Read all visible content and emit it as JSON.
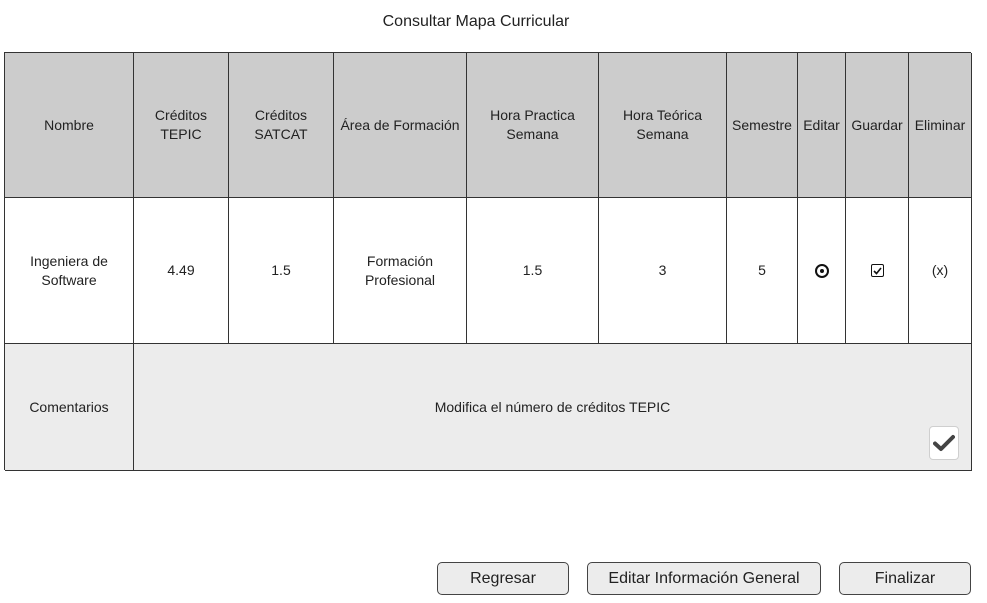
{
  "page": {
    "title": "Consultar Mapa Curricular"
  },
  "table": {
    "headers": {
      "nombre": "Nombre",
      "creditos_tepic": "Créditos TEPIC",
      "creditos_satcat": "Créditos SATCAT",
      "area_formacion": "Área de Formación",
      "hora_practica": "Hora Practica Semana",
      "hora_teorica": "Hora Teórica Semana",
      "semestre": "Semestre",
      "editar": "Editar",
      "guardar": "Guardar",
      "eliminar": "Eliminar"
    },
    "row": {
      "nombre": "Ingeniera de Software",
      "creditos_tepic": "4.49",
      "creditos_satcat": "1.5",
      "area_formacion": "Formación Profesional",
      "hora_practica": "1.5",
      "hora_teorica": "3",
      "semestre": "5",
      "editar_icon": "radio-selected-icon",
      "guardar_icon": "checkbox-checked-icon",
      "eliminar": "(x)"
    },
    "comments": {
      "label": "Comentarios",
      "text": "Modifica el número de créditos TEPIC",
      "confirm_icon": "checkmark-icon"
    }
  },
  "buttons": {
    "regresar": "Regresar",
    "editar_info": "Editar Información General",
    "finalizar": "Finalizar"
  }
}
